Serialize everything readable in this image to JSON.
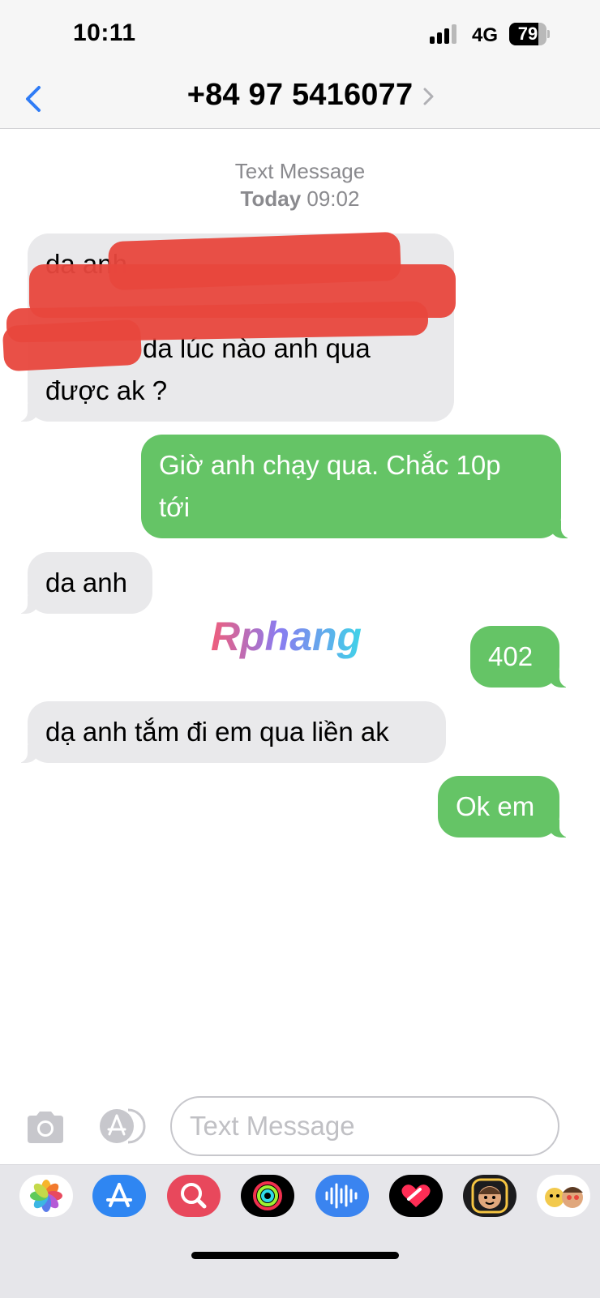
{
  "status_bar": {
    "time": "10:11",
    "network": "4G",
    "battery": "79",
    "battery_level": 0.79
  },
  "header": {
    "title": "+84 97 5416077"
  },
  "thread": {
    "label": "Text Message",
    "date_prefix": "Today",
    "date_time": "09:02",
    "messages": [
      {
        "direction": "incoming",
        "lines": [
          "da anh",
          "",
          "da lúc nào anh qua",
          "được ak ?"
        ],
        "redacted": true
      },
      {
        "direction": "outgoing",
        "lines": [
          "Giờ anh chạy qua. Chắc 10p",
          "tới"
        ]
      },
      {
        "direction": "incoming",
        "lines": [
          "da anh"
        ]
      },
      {
        "direction": "outgoing",
        "lines": [
          "402"
        ]
      },
      {
        "direction": "incoming",
        "lines": [
          "dạ anh tắm đi em qua liền ak"
        ]
      },
      {
        "direction": "outgoing",
        "lines": [
          "Ok em"
        ]
      }
    ]
  },
  "watermark": "Rphang",
  "composer": {
    "placeholder": "Text Message"
  },
  "drawer": {
    "apps": [
      "photos-icon",
      "app-store-icon",
      "search-images-icon",
      "activity-icon",
      "audio-message-icon",
      "digital-touch-icon",
      "memoji-icon",
      "memoji-stickers-icon"
    ]
  },
  "colors": {
    "outgoing_bubble": "#65c466",
    "incoming_bubble": "#e9e9eb",
    "accent": "#2f7cf6",
    "redaction": "#e8473d"
  }
}
